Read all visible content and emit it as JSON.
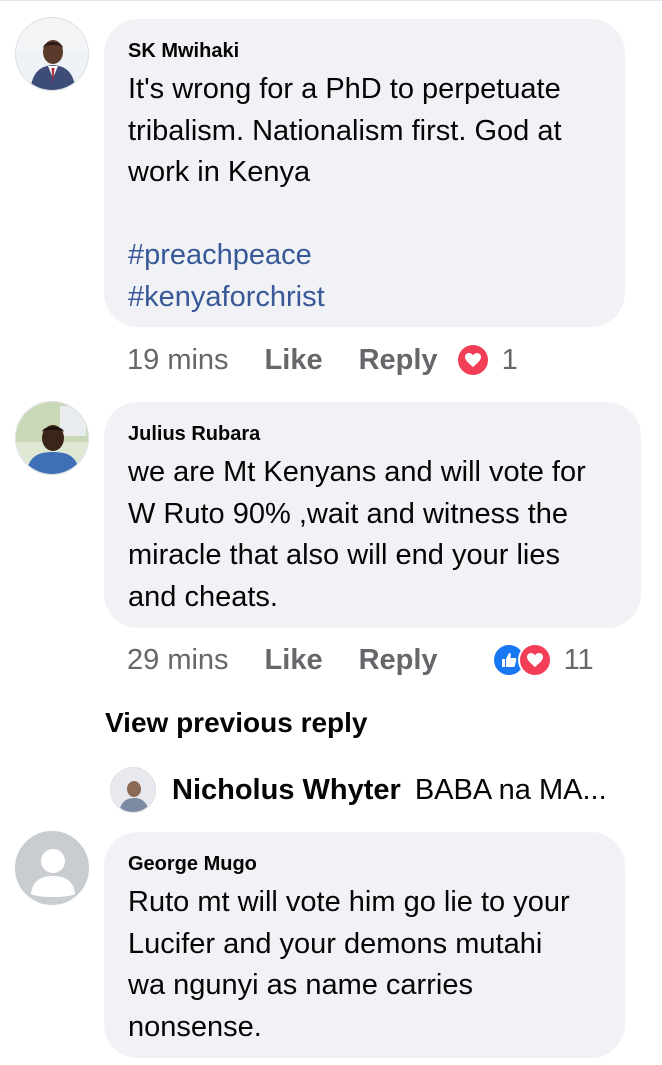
{
  "comments": [
    {
      "author": "SK Mwihaki",
      "lines": [
        "It's wrong for a PhD to perpetuate",
        "tribalism. Nationalism first. God at",
        "work in Kenya"
      ],
      "hashtags": [
        "#preachpeace",
        "#kenyaforchrist"
      ],
      "time": "19 mins",
      "like_label": "Like",
      "reply_label": "Reply",
      "reactions": [
        "heart-icon"
      ],
      "reaction_count": "1",
      "avatar": "person-in-suit-avatar"
    },
    {
      "author": "Julius Rubara",
      "lines": [
        "we are Mt Kenyans and will vote for",
        "W Ruto 90% ,wait and witness the",
        "miracle that also will end your lies",
        "and cheats."
      ],
      "time": "29 mins",
      "like_label": "Like",
      "reply_label": "Reply",
      "reactions": [
        "like-icon",
        "heart-icon"
      ],
      "reaction_count": "11",
      "avatar": "person-photo-avatar"
    },
    {
      "author": "George Mugo",
      "lines": [
        "Ruto mt will vote him go lie to your",
        "Lucifer and your demons mutahi",
        "wa ngunyi as name carries",
        "nonsense."
      ],
      "avatar": "default-silhouette-avatar"
    }
  ],
  "view_previous_reply": "View previous reply",
  "reply_preview": {
    "author": "Nicholus Whyter",
    "text": "BABA na MA..."
  },
  "colors": {
    "bubble": "#f0f2f5",
    "meta": "#65676b",
    "hashtag": "#385898",
    "heart": "#f33e58",
    "like": "#1877f2"
  }
}
